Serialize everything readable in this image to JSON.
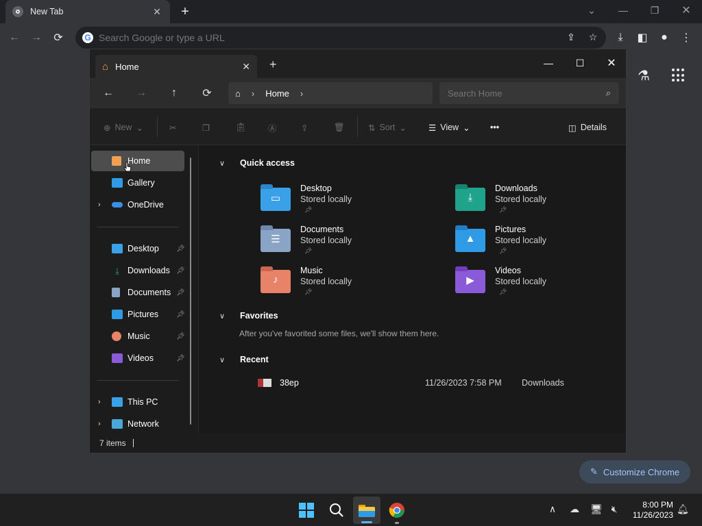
{
  "chrome": {
    "tab_title": "New Tab",
    "omnibox_placeholder": "Search Google or type a URL",
    "customize_label": "Customize Chrome"
  },
  "explorer": {
    "tab_title": "Home",
    "breadcrumb": [
      "Home"
    ],
    "search_placeholder": "Search Home",
    "commands": {
      "new": "New",
      "sort": "Sort",
      "view": "View",
      "more": "•••",
      "details": "Details"
    },
    "sidebar": {
      "top": [
        {
          "label": "Home",
          "icon": "home-icon",
          "selected": true
        },
        {
          "label": "Gallery",
          "icon": "gallery-icon"
        },
        {
          "label": "OneDrive",
          "icon": "onedrive-icon",
          "expandable": true
        }
      ],
      "pinned": [
        {
          "label": "Desktop",
          "icon": "desktop-folder-icon"
        },
        {
          "label": "Downloads",
          "icon": "downloads-folder-icon"
        },
        {
          "label": "Documents",
          "icon": "documents-folder-icon"
        },
        {
          "label": "Pictures",
          "icon": "pictures-folder-icon"
        },
        {
          "label": "Music",
          "icon": "music-folder-icon"
        },
        {
          "label": "Videos",
          "icon": "videos-folder-icon"
        }
      ],
      "bottom": [
        {
          "label": "This PC",
          "icon": "this-pc-icon",
          "expandable": true
        },
        {
          "label": "Network",
          "icon": "network-icon",
          "expandable": true
        }
      ]
    },
    "sections": {
      "quick_access": "Quick access",
      "favorites": "Favorites",
      "favorites_empty": "After you've favorited some files, we'll show them here.",
      "recent": "Recent"
    },
    "quick_access": [
      {
        "name": "Desktop",
        "sub": "Stored locally",
        "color": "#3aa0e8"
      },
      {
        "name": "Downloads",
        "sub": "Stored locally",
        "color": "#1fa38a"
      },
      {
        "name": "Documents",
        "sub": "Stored locally",
        "color": "#8aa4c6"
      },
      {
        "name": "Pictures",
        "sub": "Stored locally",
        "color": "#2f9be6"
      },
      {
        "name": "Music",
        "sub": "Stored locally",
        "color": "#e8836a"
      },
      {
        "name": "Videos",
        "sub": "Stored locally",
        "color": "#8b5ad8"
      }
    ],
    "recent": [
      {
        "name": "38ep",
        "date": "11/26/2023 7:58 PM",
        "location": "Downloads"
      }
    ],
    "status": "7 items"
  },
  "taskbar": {
    "time": "8:00 PM",
    "date": "11/26/2023"
  }
}
